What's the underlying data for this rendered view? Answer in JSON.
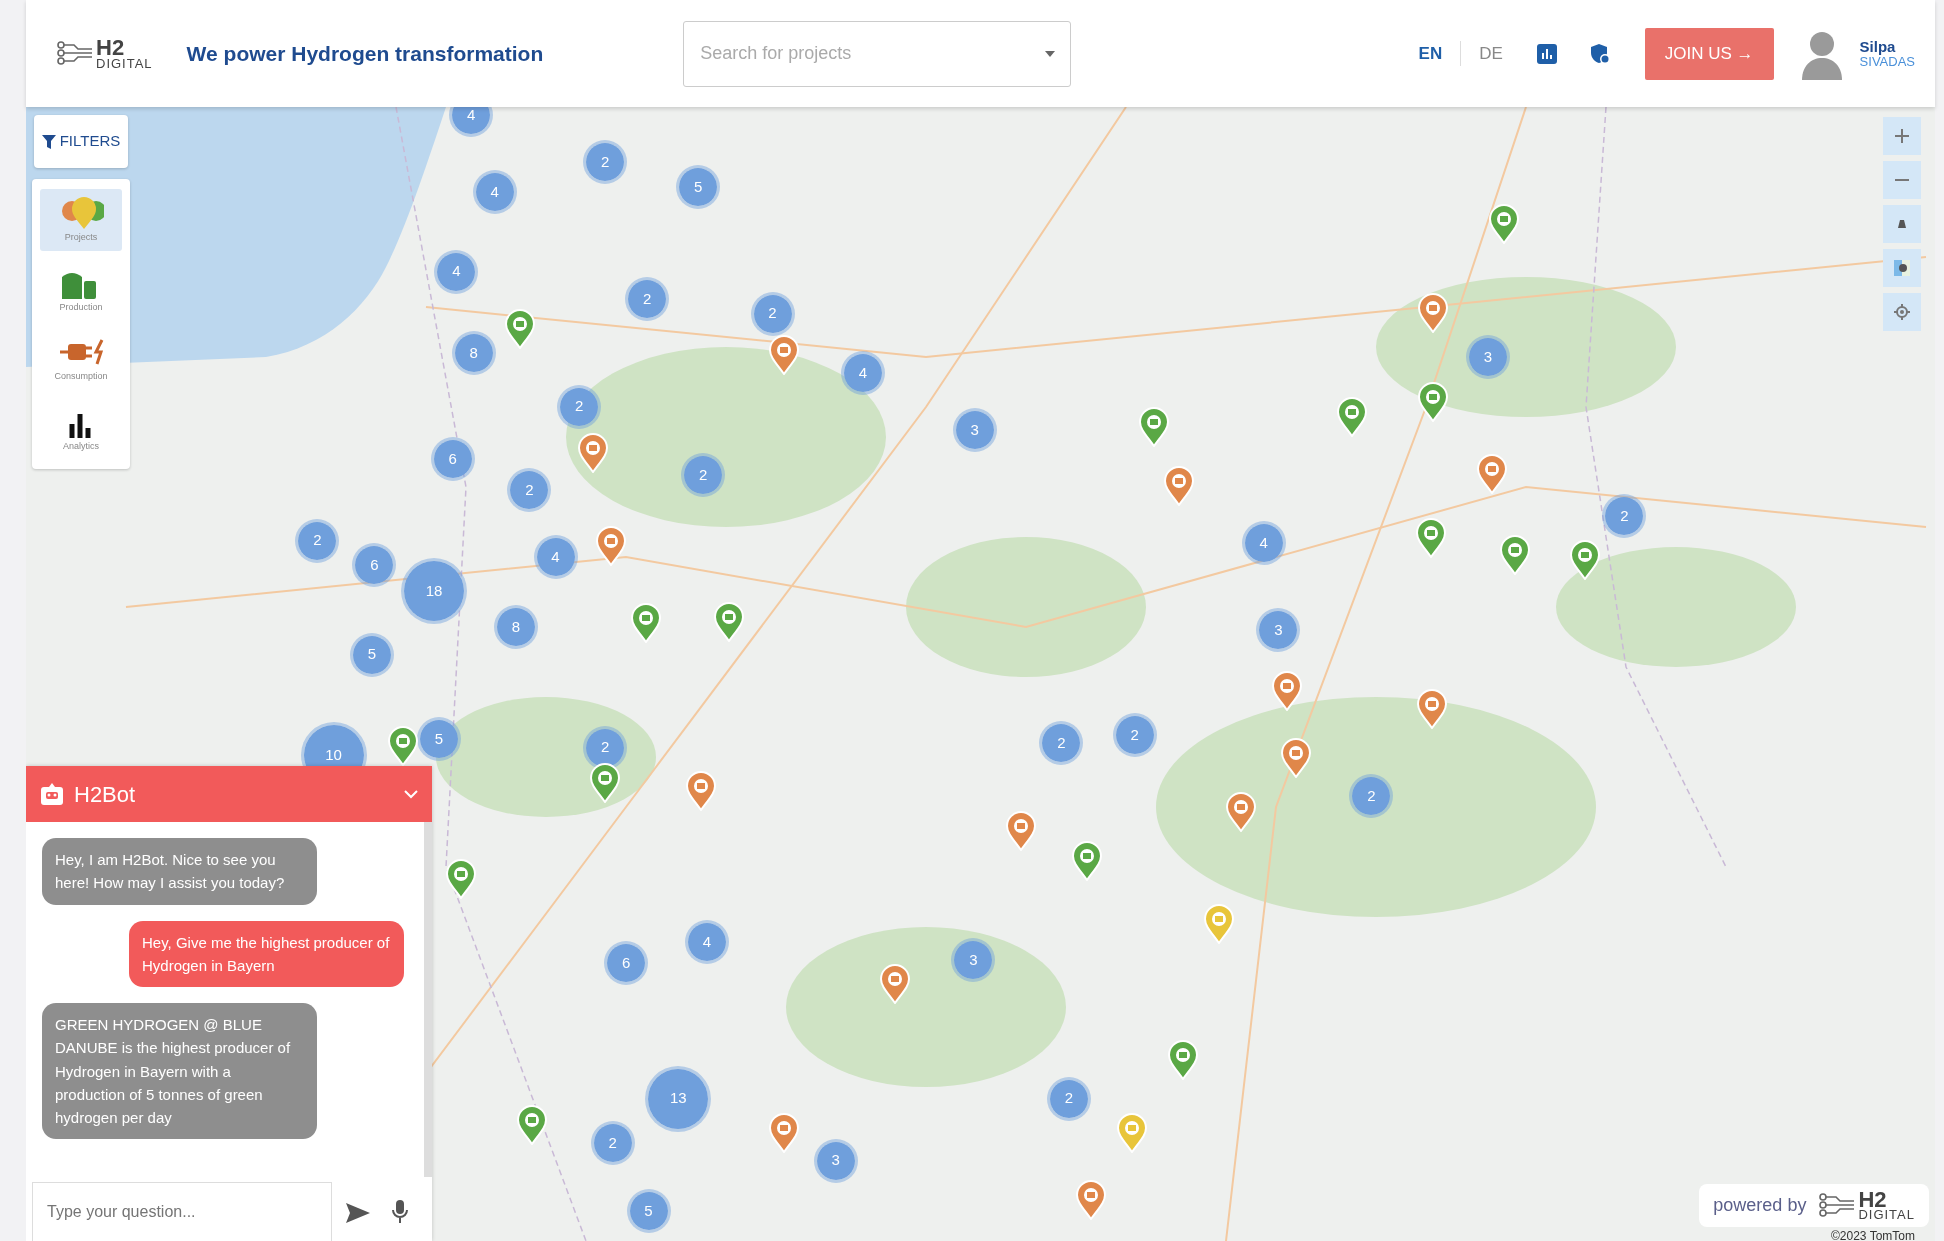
{
  "header": {
    "logo_top": "H2",
    "logo_bottom": "DIGITAL",
    "tagline": "We power Hydrogen transformation",
    "search": {
      "placeholder": "Search for projects"
    },
    "languages": [
      {
        "label": "EN",
        "selected": true
      },
      {
        "label": "DE",
        "selected": false
      }
    ],
    "join_button": "JOIN US →",
    "user": {
      "first_name": "Silpa",
      "last_name": "SIVADAS"
    }
  },
  "filters_button": "FILTERS",
  "sidebar": {
    "items": [
      {
        "label": "Projects",
        "kind": "projects",
        "selected": true
      },
      {
        "label": "Production",
        "kind": "production",
        "selected": false
      },
      {
        "label": "Consumption",
        "kind": "consumption",
        "selected": false
      },
      {
        "label": "Analytics",
        "kind": "analytics",
        "selected": false
      }
    ]
  },
  "map": {
    "clusters": [
      "4",
      "2",
      "5",
      "4",
      "4",
      "2",
      "2",
      "8",
      "4",
      "2",
      "3",
      "3",
      "6",
      "2",
      "2",
      "2",
      "2",
      "4",
      "6",
      "18",
      "4",
      "8",
      "3",
      "5",
      "10",
      "5",
      "2",
      "2",
      "2",
      "2",
      "4",
      "6",
      "3",
      "13",
      "2",
      "3",
      "2",
      "5"
    ],
    "pins": [
      {
        "kind": "production"
      },
      {
        "kind": "production"
      },
      {
        "kind": "production"
      },
      {
        "kind": "production"
      },
      {
        "kind": "production"
      },
      {
        "kind": "production"
      },
      {
        "kind": "production"
      },
      {
        "kind": "production"
      },
      {
        "kind": "production"
      },
      {
        "kind": "production"
      },
      {
        "kind": "production"
      },
      {
        "kind": "production"
      },
      {
        "kind": "production"
      },
      {
        "kind": "production"
      },
      {
        "kind": "production"
      },
      {
        "kind": "production"
      },
      {
        "kind": "consumption"
      },
      {
        "kind": "consumption"
      },
      {
        "kind": "consumption"
      },
      {
        "kind": "consumption"
      },
      {
        "kind": "consumption"
      },
      {
        "kind": "consumption"
      },
      {
        "kind": "consumption"
      },
      {
        "kind": "consumption"
      },
      {
        "kind": "consumption"
      },
      {
        "kind": "consumption"
      },
      {
        "kind": "consumption"
      },
      {
        "kind": "consumption"
      },
      {
        "kind": "consumption"
      },
      {
        "kind": "consumption"
      },
      {
        "kind": "consumption"
      },
      {
        "kind": "hydrogen"
      },
      {
        "kind": "hydrogen"
      }
    ],
    "copyright": "©2023 TomTom"
  },
  "powered_by": {
    "text": "powered by",
    "logo_top": "H2",
    "logo_bottom": "DIGITAL"
  },
  "chatbot": {
    "title": "H2Bot",
    "messages": [
      {
        "kind": "bot",
        "text": "Hey, I am H2Bot. Nice to see you here! How may I assist you today?"
      },
      {
        "kind": "user",
        "text": "Hey, Give me the highest producer of Hydrogen in Bayern"
      },
      {
        "kind": "bot",
        "text": "GREEN HYDROGEN @ BLUE DANUBE is the highest producer of Hydrogen in Bayern with a production of 5 tonnes of green hydrogen per day"
      }
    ],
    "input": {
      "placeholder": "Type your question..."
    }
  }
}
